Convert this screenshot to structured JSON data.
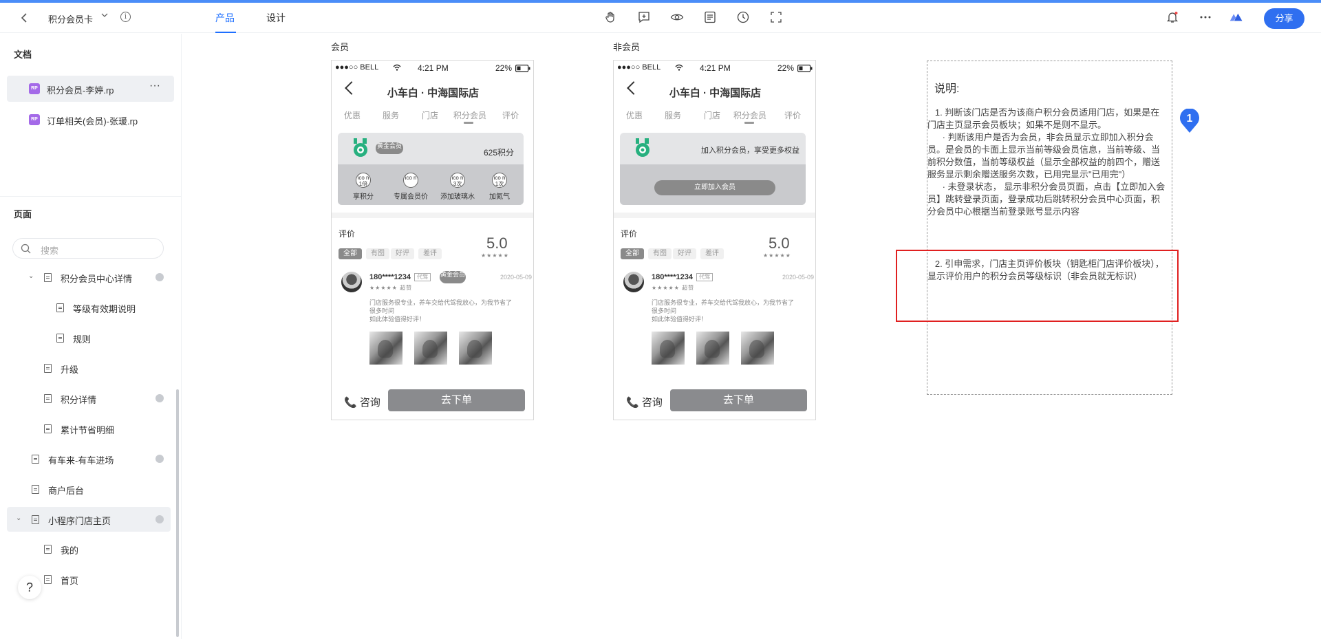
{
  "topbar": {
    "doc_title": "积分会员卡",
    "tabs": [
      "产品",
      "设计"
    ],
    "share_label": "分享",
    "tools": [
      "hand-icon",
      "comment-add-icon",
      "eye-icon",
      "notes-icon",
      "history-icon",
      "fullscreen-icon"
    ]
  },
  "sidebar": {
    "docs_heading": "文档",
    "files": [
      {
        "label": "积分会员-李婷.rp",
        "selected": true
      },
      {
        "label": "订单相关(会员)-张瑗.rp",
        "selected": false
      }
    ],
    "more_label": "···",
    "pages_heading": "页面",
    "search_placeholder": "搜索",
    "tree": [
      {
        "label": "积分会员中心详情",
        "expanded": true,
        "dot": true
      },
      {
        "label": "等级有效期说明",
        "dot": false
      },
      {
        "label": "规则",
        "dot": false
      },
      {
        "label": "升级",
        "dot": false
      },
      {
        "label": "积分详情",
        "dot": true
      },
      {
        "label": "累计节省明细",
        "dot": false
      },
      {
        "label": "有车来-有车进场",
        "dot": true
      },
      {
        "label": "商户后台",
        "dot": false
      },
      {
        "label": "小程序门店主页",
        "expanded": true,
        "dot": true,
        "selected": true
      },
      {
        "label": "我的",
        "dot": false
      },
      {
        "label": "首页",
        "dot": false
      }
    ],
    "help_label": "?"
  },
  "phones": [
    {
      "label": "会员",
      "status": {
        "carrier": "●●●○○ BELL",
        "time": "4:21 PM",
        "battery": "22%"
      },
      "title": "小车白 · 中海国际店",
      "tabs": [
        "优惠",
        "服务",
        "门店",
        "积分会员",
        "评价"
      ],
      "member_level": "黄金会员",
      "points": "625积分",
      "benefits": [
        {
          "icon": "ico n 1倍",
          "label": "享积分"
        },
        {
          "icon": "ico n",
          "label": "专属会员价"
        },
        {
          "icon": "ico n 3次",
          "label": "添加玻璃水"
        },
        {
          "icon": "ico n 1次",
          "label": "加氮气"
        }
      ],
      "review_title": "评价",
      "score": "5.0",
      "score_stars": "★★★★★",
      "filters": [
        "全部",
        "有图",
        "好评",
        "差评"
      ],
      "review": {
        "name": "180****1234",
        "tag": "代驾",
        "level": "黄金会员",
        "date": "2020-05-09",
        "stars": "★★★★★ 超赞",
        "text": "门店服务很专业，养车交给代驾我放心，为我节省了很多时间\n如此体验值得好评！"
      },
      "consult": "咨询",
      "order": "去下单"
    },
    {
      "label": "非会员",
      "status": {
        "carrier": "●●●○○ BELL",
        "time": "4:21 PM",
        "battery": "22%"
      },
      "title": "小车白 · 中海国际店",
      "tabs": [
        "优惠",
        "服务",
        "门店",
        "积分会员",
        "评价"
      ],
      "join_text": "加入积分会员，享受更多权益",
      "join_button": "立即加入会员",
      "review_title": "评价",
      "score": "5.0",
      "score_stars": "★★★★★",
      "filters": [
        "全部",
        "有图",
        "好评",
        "差评"
      ],
      "review": {
        "name": "180****1234",
        "tag": "代驾",
        "date": "2020-05-09",
        "stars": "★★★★★ 超赞",
        "text": "门店服务很专业，养车交给代驾我放心，为我节省了很多时间\n如此体验值得好评！"
      },
      "consult": "咨询",
      "order": "去下单"
    }
  ],
  "notes": {
    "title": "说明:",
    "body": "   1. 判断该门店是否为该商户积分会员适用门店，如果是在门店主页显示会员板块；如果不是则不显示。\n      · 判断该用户是否为会员，非会员显示立即加入积分会员。是会员的卡面上显示当前等级会员信息，当前等级、当前积分数值，当前等级权益（显示全部权益的前四个，赠送服务显示剩余赠送服务次数，已用完显示\"已用完\"）\n      · 未登录状态， 显示非积分会员页面，点击【立即加入会员】跳转登录页面，登录成功后跳转积分会员中心页面，积分会员中心根据当前登录账号显示内容",
    "body2": "   2. 引申需求，门店主页评价板块（钥匙柜门店评价板块），显示评价用户的积分会员等级标识（非会员就无标识）",
    "marker": "1",
    "colors": {
      "highlight": "#e02020",
      "marker": "#2f6ff0"
    }
  }
}
